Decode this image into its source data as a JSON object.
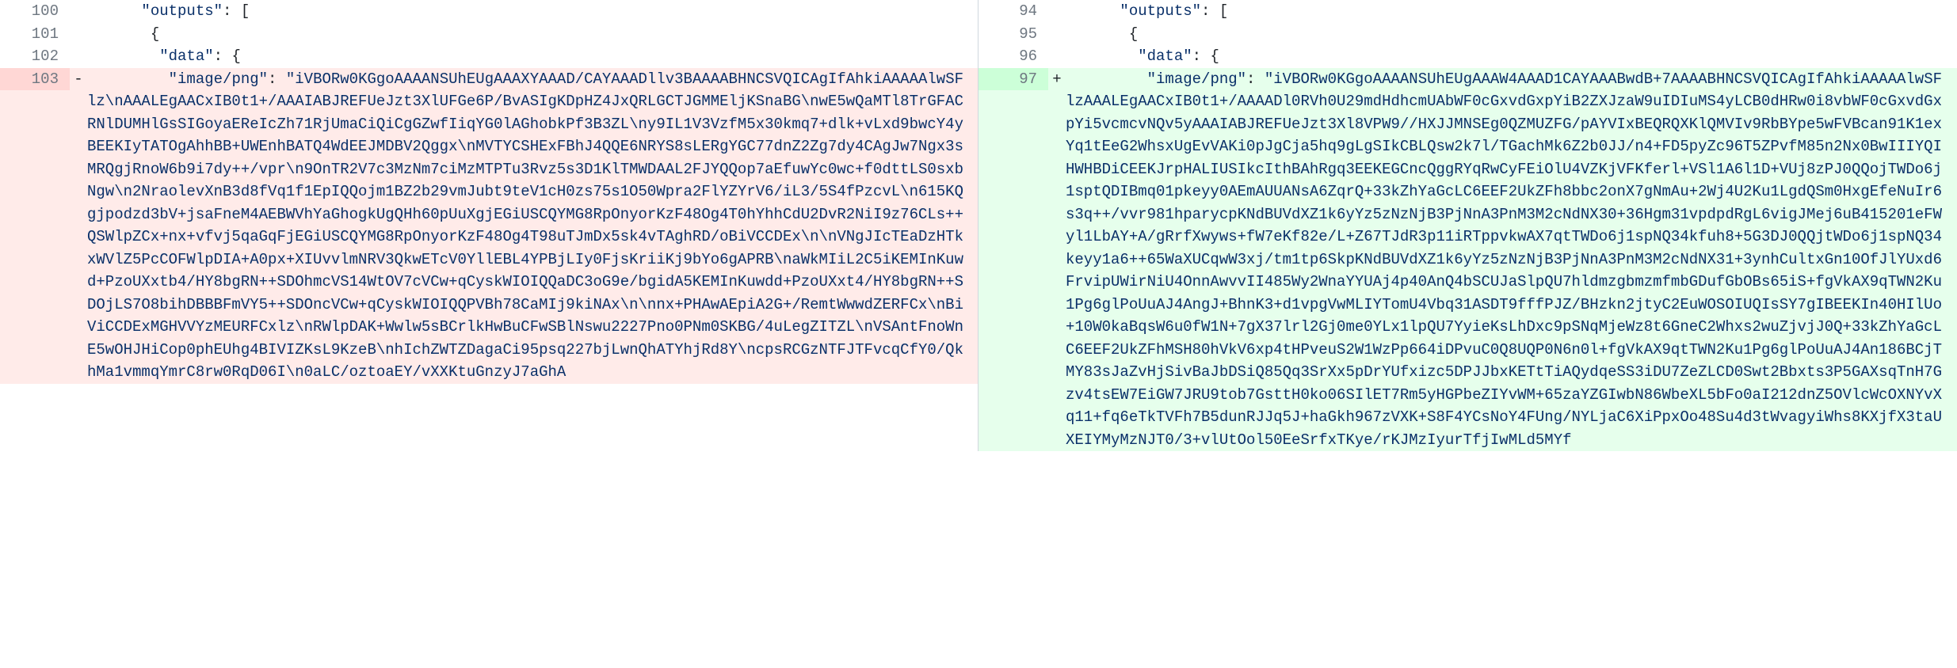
{
  "diff": {
    "left": {
      "context_lines": [
        {
          "num": 100,
          "indent": "      ",
          "tokens": [
            [
              "key",
              "\"outputs\""
            ],
            [
              "punct",
              ": ["
            ]
          ]
        },
        {
          "num": 101,
          "indent": "       ",
          "tokens": [
            [
              "punct",
              "{"
            ]
          ]
        },
        {
          "num": 102,
          "indent": "        ",
          "tokens": [
            [
              "key",
              "\"data\""
            ],
            [
              "punct",
              ": {"
            ]
          ]
        }
      ],
      "deletion": {
        "num": 103,
        "marker": "-",
        "first_indent": "         ",
        "key": "\"image/png\"",
        "colon": ":",
        "value": "\"iVBORw0KGgoAAAANSUhEUgAAAXYAAAD/CAYAAADllv3BAAAABHNCSVQICAgIfAhkiAAAAAlwSFlz\\nAAALEgAACxIB0t1+/AAAIABJREFUeJzt3XlUFGe6P/BvASIgKDpHZ4JxQRLGCTJGMMEljKSnaBG\\nwE5wQaMTl8TrGFACRNlDUMHlGsSIGoyaEReIcZh71RjUmaCiQiCgGZwfIiqYG0lAGhobkPf3B3ZL\\ny9IL1V3VzfM5x30kmq7+dlk+vLxd9bwcY4yBEEKIyTATOgAhhBB+UWEnhBATQ4WdEEJMDBV2Qggx\\nMVTYCSHExFBhJ4QQE6NRYS8sLERgYGC77dnZ2Zg7dy4CAgJw7Ngx3sMRQgjRnoW6b9i7dy++/vpr\\n9OnTR2V7c3MzNm7ciMzMTPTu3Rvz5s3D1KlTMWDAAL2FJYQQop7aEfuwYc0wc+f0dttLS0sxbNgw\\n2NraolevXnB3d8fVq1f1EpIQQojm1BZ2b29vmJubt9teV1cH0zs75s1O50Wpra2FlYZYrV6/iL3/5S4fPzcvL\\n615KQgjpodzd3bV+jsaFneM4AEBWVhYaGhogkUgQHh60pUuXgjEGiUSCQYMG8RpOnyorKzF48Og4T0hYhhCdU2DvR2NiI9z76CLs++QSWlpZCx+nx+vfvj5qaGqFjEGiUSCQYMG8RpOnyorKzF48Og4T98uTJmDx5sk4vTAghRD/oBiVCCDEx\\n\\nVNgJIcTEaDzHTkxWVlZ5PcCOFWlpDIA+A0px+XIUvvlmNRV3QkwETcV0YllEBL4YPBjLIy0FjsKriiKj9bYo6gAPRB\\naWkMIiL2C5iKEMInKuwd+PzoUXxtb4/HY8bgRN++SDOhmcVS14WtOV7cVCw+qCyskWIOIQQaDC3oG9e/bgidA5KEMInKuwdd+PzoUXxt4/HY8bgRN++SDOjLS7O8bihDBBBFmVY5++SDOncVCw+qCyskWIOIQQPVBh78CaMIj9kiNAx\\n\\nnx+PHAwAEpiA2G+/RemtWwwdZERFCx\\nBiViCCDExMGHVVYzMEURFCxlz\\nRWlpDAK+Wwlw5sBCrlkHwBuCFwSBlNswu2227Pno0PNm0SKBG/4uLegZITZL\\nVSAntFnoWnE5wOHJHiCop0phEUhg4BIVIZKsL9KzeB\\nhIchZWTZDagaCi95psq227bjLwnQhATYhjRd8Y\\ncpsRCGzNTFJTFvcqCfY0/QkhMa1vmmqYmrC8rw0RqD06I\\n0aLC/oztoaEY/vXXKtuGnzyJ7aGhA"
      }
    },
    "right": {
      "context_lines": [
        {
          "num": 94,
          "indent": "      ",
          "tokens": [
            [
              "key",
              "\"outputs\""
            ],
            [
              "punct",
              ": ["
            ]
          ]
        },
        {
          "num": 95,
          "indent": "       ",
          "tokens": [
            [
              "punct",
              "{"
            ]
          ]
        },
        {
          "num": 96,
          "indent": "        ",
          "tokens": [
            [
              "key",
              "\"data\""
            ],
            [
              "punct",
              ": {"
            ]
          ]
        }
      ],
      "addition": {
        "num": 97,
        "marker": "+",
        "first_indent": "         ",
        "key": "\"image/png\"",
        "colon": ":",
        "value": "\"iVBORw0KGgoAAAANSUhEUgAAAW4AAAD1CAYAAABwdB+7AAAABHNCSVQICAgIfAhkiAAAAAlwSFlzAAALEgAACxIB0t1+/AAAADl0RVh0U29mdHdhcmUAbWF0cGxvdGxpYiB2ZXJzaW9uIDIuMS4yLCB0dHRw0i8vbWF0cGxvdGxpYi5vcmcvNQv5yAAAIABJREFUeJzt3Xl8VPW9//HXJJMNSEg0QZMUZFG/pAYVIxBEQRQXKlQMVIv9RbBYpe5wFVBcan91K1exYq1tEeG2WhsxUgEvVAKi0pJgCja5hq9gLgSIkCBLQsw2k7l/TGachMk6Z2b0JJ/n4+FD5pyZc96T5ZPvfM85n2Nx0BwIIIYQIHWHBDiCEEKJrpHALIUSIkcIthBAhRgq3EEKEGCncQggRYqRwCyFEiOlU4VZKjVFKferl+VSl1A6l1D+VUj8zPJ0QQojTWDo6j1sptQDIBmq01pkeyy0AEmAUUANsA6ZqrQ+33kZhYaGcLC6EEF2UkZFh8bbc2onX7gNmAu+2Wj4U2Ku1LgdQSm0HxgEfeNuIr6s3q++/vvr981hparycpKNdBUVdXZ1k6yYz5zNzNjB3PjNnA3PnM3M2cNdNX30+36Hgm31vpdpdRgL6vigJMej6uB415201eFWyl1LbAY+A/gRrfXwyws+fW7eKf82e/L+Z67TJdR3p11iRTppvkwAX7qtTWDo6j1spNQ34kfuh8+5G3DJ0QQjtWDo6j1spNQ34keyy1a6++65WaXUCqwW3xj/tm1tp6SkpKNdBUVdXZ1k6yYz5zNzNjB3PjNnA3PnM3M2cNdNX31+3ynhCultxGn10OfJlYUxd6FrvipUWirNiU4OnnAwvvII485Wy2WnaYYUAj4p40AnQ4bSCUJaSlpQU7hldmzgbmzmfmbGDufGbOBs65iS+fgVkAX9qTWN2Ku1Pg6glPoUuAJ4AngJ+BhnK3+d1vpgVwMLIYTomU4Vbq31ASDT9fffPJZ/BHzkn2jtyC2EuWOSOIUQIsSY7gIBEEKIn40HIlUo+10W0kaBqsW6u0fW1N+7gX37lrl2Gj0me0YLx1lpQU7YyieKsLhDxc9pSNqMjeWz8t6GneC2Whxs2wuZjvjJ0Q+33kZhYaGcLC6EEF2UkZFhMSH80hVkV6xp4tHPveuS2W1WzPp664iDPvuC0Q8UQP0N6n0l+fgVkAX9qtTWN2Ku1Pg6glPoUuAJ4An186BCjTMY83sJaZvHjSivBaJbDSiQ85Qq3SrXx5pDrYUfxizc5DPJJbxKETtTiAQydqeSS3iDU7ZeZLCD0Swt2Bbxts3P5GAXsqTnH7Gzv4tsEW7EiGW7JRU9tob7GsttH0ko06SIlET7Rm5yHGPbeZIYvWM+65zaYZGIwbN86WbeXL5bFo0aI212dnZ5OVlcWcOXNYvXq11+fq6eTkTVFh7B5dunRJJq5J+haGkh967zVXK+S8F4YCsNoY4FUng/NYLjaC6XiPpxOo48Su4d3tWvagyiWhs8KXjfX3taUXEIYMyMzNJT0/3+vlUtOol50EeSrfxTKye/rKJMzIyurTfjIwMLd5MYf"
      }
    }
  }
}
